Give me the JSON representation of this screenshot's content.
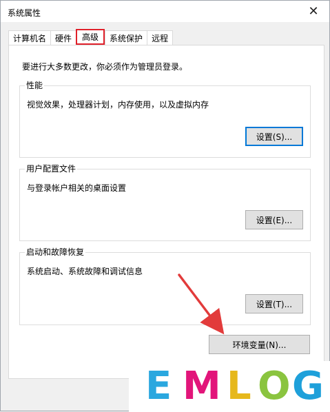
{
  "window": {
    "title": "系统属性",
    "close_glyph": "✕"
  },
  "tabs": [
    {
      "label": "计算机名",
      "active": false
    },
    {
      "label": "硬件",
      "active": false
    },
    {
      "label": "高级",
      "active": true
    },
    {
      "label": "系统保护",
      "active": false
    },
    {
      "label": "远程",
      "active": false
    }
  ],
  "intro_text": "要进行大多数更改，你必须作为管理员登录。",
  "groups": {
    "performance": {
      "legend": "性能",
      "description": "视觉效果，处理器计划，内存使用，以及虚拟内存",
      "button_label": "设置(S)..."
    },
    "user_profiles": {
      "legend": "用户配置文件",
      "description": "与登录帐户相关的桌面设置",
      "button_label": "设置(E)..."
    },
    "startup_recovery": {
      "legend": "启动和故障恢复",
      "description": "系统启动、系统故障和调试信息",
      "button_label": "设置(T)..."
    }
  },
  "env_button_label": "环境变量(N)...",
  "watermark": {
    "letters": [
      "E",
      "M",
      "L",
      "O",
      "G"
    ],
    "colors": {
      "E": "#2aa7df",
      "M": "#e2157a",
      "L": "#e6b81c",
      "O": "#8ac43f",
      "G": "#1ea0da"
    }
  },
  "colors": {
    "highlight_box": "#e0202a",
    "annotation_arrow": "#e23b3b",
    "focus_blue": "#0078d7"
  }
}
